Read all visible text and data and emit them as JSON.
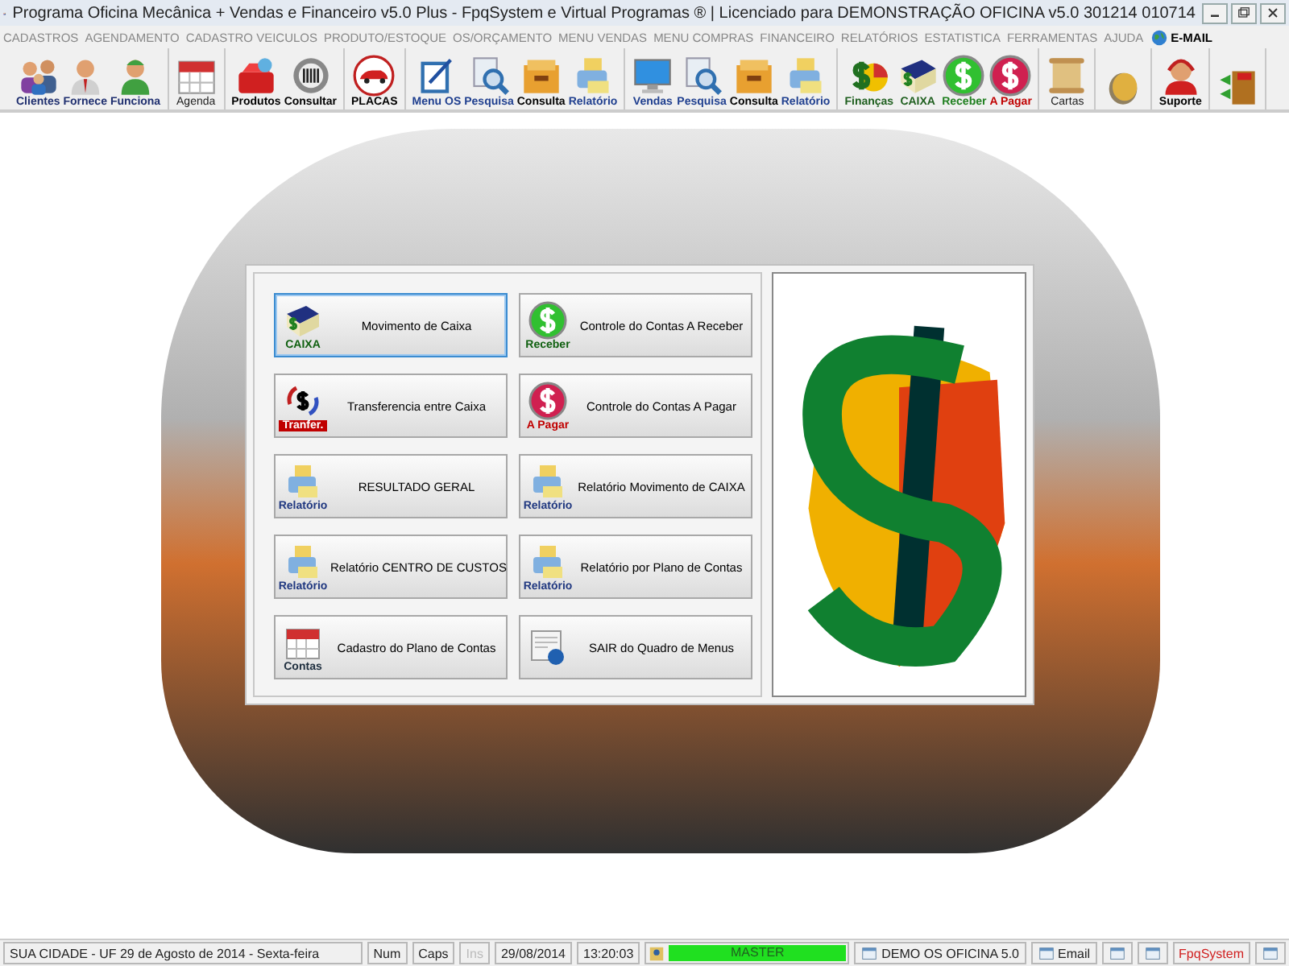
{
  "window": {
    "title": "Programa Oficina Mecânica + Vendas e Financeiro v5.0 Plus - FpqSystem e Virtual Programas ® | Licenciado para  DEMONSTRAÇÃO OFICINA v5.0 301214 010714"
  },
  "menu": [
    "CADASTROS",
    "AGENDAMENTO",
    "CADASTRO VEICULOS",
    "PRODUTO/ESTOQUE",
    "OS/ORÇAMENTO",
    "MENU VENDAS",
    "MENU COMPRAS",
    "FINANCEIRO",
    "RELATÓRIOS",
    "ESTATISTICA",
    "FERRAMENTAS",
    "AJUDA"
  ],
  "menu_email": "E-MAIL",
  "toolbar": [
    [
      {
        "kind": "people",
        "label": "Clientes"
      },
      {
        "kind": "person",
        "label": "Fornece"
      },
      {
        "kind": "worker",
        "label": "Funciona"
      }
    ],
    [
      {
        "kind": "calendar",
        "label": "Agenda"
      }
    ],
    [
      {
        "kind": "toolbox",
        "label": "Produtos"
      },
      {
        "kind": "barcode",
        "label": "Consultar"
      }
    ],
    [
      {
        "kind": "car",
        "label": "PLACAS"
      }
    ],
    [
      {
        "kind": "clipboard",
        "label": "Menu OS"
      },
      {
        "kind": "search",
        "label": "Pesquisa"
      },
      {
        "kind": "folder",
        "label": "Consulta"
      },
      {
        "kind": "printer",
        "label": "Relatório"
      }
    ],
    [
      {
        "kind": "monitor",
        "label": "Vendas"
      },
      {
        "kind": "search",
        "label": "Pesquisa"
      },
      {
        "kind": "folder",
        "label": "Consulta"
      },
      {
        "kind": "printer",
        "label": "Relatório"
      }
    ],
    [
      {
        "kind": "finance",
        "label": "Finanças"
      },
      {
        "kind": "book",
        "label": "CAIXA"
      },
      {
        "kind": "coin-green",
        "label": "Receber"
      },
      {
        "kind": "coin-red",
        "label": "A Pagar"
      }
    ],
    [
      {
        "kind": "scroll",
        "label": "Cartas"
      }
    ],
    [
      {
        "kind": "coin"
      }
    ],
    [
      {
        "kind": "support",
        "label": "Suporte"
      }
    ],
    [
      {
        "kind": "exit"
      }
    ]
  ],
  "panel": {
    "buttons": [
      {
        "kind": "book",
        "caption": "CAIXA",
        "label": "Movimento de Caixa",
        "selected": true
      },
      {
        "kind": "coin-green",
        "caption": "Receber",
        "label": "Controle do Contas A Receber",
        "selected": false
      },
      {
        "kind": "transfer",
        "caption": "Tranfer.",
        "label": "Transferencia entre Caixa",
        "selected": false
      },
      {
        "kind": "coin-red",
        "caption": "A Pagar",
        "label": "Controle do Contas A Pagar",
        "selected": false
      },
      {
        "kind": "printer",
        "caption": "Relatório",
        "label": "RESULTADO GERAL",
        "selected": false
      },
      {
        "kind": "printer",
        "caption": "Relatório",
        "label": "Relatório Movimento de CAIXA",
        "selected": false
      },
      {
        "kind": "printer",
        "caption": "Relatório",
        "label": "Relatório CENTRO DE CUSTOS",
        "selected": false
      },
      {
        "kind": "printer",
        "caption": "Relatório",
        "label": "Relatório por Plano de Contas",
        "selected": false
      },
      {
        "kind": "calendar",
        "caption": "Contas",
        "label": "Cadastro do Plano de Contas",
        "selected": false
      },
      {
        "kind": "document",
        "label": "SAIR do Quadro de Menus",
        "selected": false
      }
    ]
  },
  "status_bar": [
    {
      "kind": "text",
      "text": "SUA CIDADE - UF 29 de Agosto de 2014 - Sexta-feira"
    },
    {
      "kind": "text",
      "text": "Num"
    },
    {
      "kind": "text",
      "text": "Caps"
    },
    {
      "kind": "disabled",
      "text": "Ins"
    },
    {
      "kind": "text",
      "text": "29/08/2014"
    },
    {
      "kind": "text",
      "text": "13:20:03"
    },
    {
      "kind": "user",
      "text": "MASTER"
    },
    {
      "kind": "icon-text",
      "text": "DEMO OS OFICINA 5.0"
    },
    {
      "kind": "icon-text",
      "text": "Email"
    },
    {
      "kind": "icon"
    },
    {
      "kind": "icon"
    },
    {
      "kind": "brand",
      "text": "FpqSystem"
    },
    {
      "kind": "icon"
    }
  ]
}
